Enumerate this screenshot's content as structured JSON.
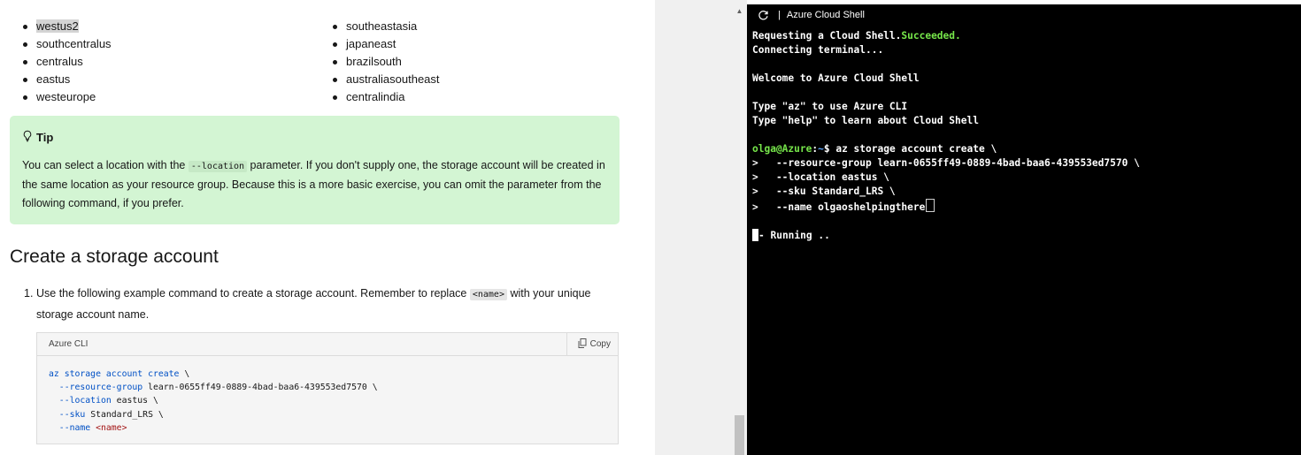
{
  "regions": {
    "left": [
      "westus2",
      "southcentralus",
      "centralus",
      "eastus",
      "westeurope"
    ],
    "right": [
      "southeastasia",
      "japaneast",
      "brazilsouth",
      "australiasoutheast",
      "centralindia"
    ]
  },
  "tip": {
    "title": "Tip",
    "text_before": "You can select a location with the ",
    "code": "--location",
    "text_after": " parameter. If you don't supply one, the storage account will be created in the same location as your resource group. Because this is a more basic exercise, you can omit the parameter from the following command, if you prefer."
  },
  "section": {
    "title": "Create a storage account",
    "step_number": "1.",
    "step_before": "Use the following example command to create a storage account. Remember to replace ",
    "step_code": "<name>",
    "step_after": " with your unique storage account name."
  },
  "codeblock": {
    "language": "Azure CLI",
    "copy_label": "Copy",
    "line1_cmd": "az storage account create",
    "line1_tail": " \\",
    "line2_flag": "--resource-group",
    "line2_val": " learn-0655ff49-0889-4bad-baa6-439553ed7570 \\",
    "line3_flag": "--location",
    "line3_val": " eastus \\",
    "line4_flag": "--sku",
    "line4_val": " Standard_LRS \\",
    "line5_flag": "--name",
    "line5_ph": "<name>"
  },
  "shell": {
    "title": "Azure Cloud Shell",
    "line_requesting": "Requesting a Cloud Shell.",
    "line_succeeded": "Succeeded.",
    "line_connecting": "Connecting terminal...",
    "line_welcome": "Welcome to Azure Cloud Shell",
    "line_type_az": "Type \"az\" to use Azure CLI",
    "line_type_help": "Type \"help\" to learn about Cloud Shell",
    "prompt_user": "olga@Azure",
    "prompt_colon": ":",
    "prompt_path": "~",
    "prompt_cmd": "$ az storage account create \\",
    "cont1": ">   --resource-group learn-0655ff49-0889-4bad-baa6-439553ed7570 \\",
    "cont2": ">   --location eastus \\",
    "cont3": ">   --sku Standard_LRS \\",
    "cont4": ">   --name olgaoshelpingthere",
    "running": "- Running .."
  },
  "colors": {
    "tip_background": "#d3f5d3",
    "terminal_background": "#000000",
    "success_green": "#76e64a",
    "link_blue": "#0050c5"
  },
  "icons": [
    "lightbulb-icon",
    "copy-icon",
    "reload-icon",
    "scroll-up-arrow-icon"
  ]
}
